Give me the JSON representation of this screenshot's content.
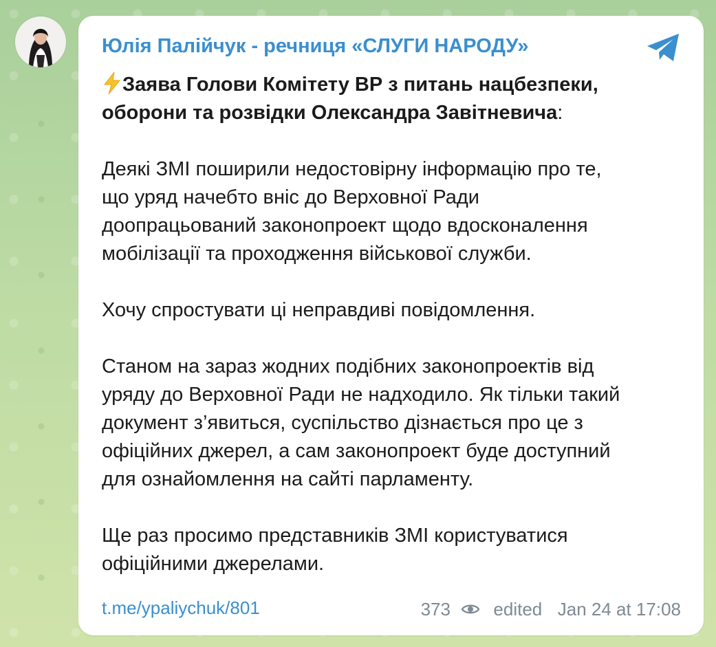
{
  "channel": {
    "name": "Юлія Палійчук - речниця «СЛУГИ НАРОДУ»",
    "accent_color": "#3a8fcf"
  },
  "icons": {
    "avatar": "profile-photo",
    "brand": "telegram-plane-icon",
    "lightning": "high-voltage-emoji",
    "views": "eye-icon"
  },
  "message": {
    "headline_bold": "Заява Голови Комітету ВР з питань нацбезпеки, оборони та розвідки Олександра Завітневича",
    "headline_suffix": ":",
    "paragraph_1_line_1": "Деякі ЗМІ поширили недостовірну інформацію про те,",
    "paragraph_1_line_2": "що уряд начебто вніс до Верховної Ради",
    "paragraph_1_line_3": "доопрацьований законопроект щодо вдосконалення",
    "paragraph_1_line_4": "мобілізації та проходження військової служби.",
    "paragraph_2": "Хочу спростувати ці неправдиві повідомлення.",
    "paragraph_3_line_1": "Станом на зараз жодних подібних законопроектів від",
    "paragraph_3_line_2": "уряду до Верховної Ради не надходило. Як тільки такий",
    "paragraph_3_line_3": "документ з’явиться, суспільство дізнається про це з",
    "paragraph_3_line_4": "офіційних джерел, а сам законопроект буде доступний",
    "paragraph_3_line_5": "для ознайомлення на сайті парламенту.",
    "paragraph_4_line_1": "Ще раз просимо представників ЗМІ користуватися",
    "paragraph_4_line_2": "офіційними джерелами."
  },
  "footer": {
    "link": "t.me/ypaliychuk/801",
    "views": "373",
    "edited_label": "edited",
    "timestamp": "Jan 24 at 17:08"
  }
}
